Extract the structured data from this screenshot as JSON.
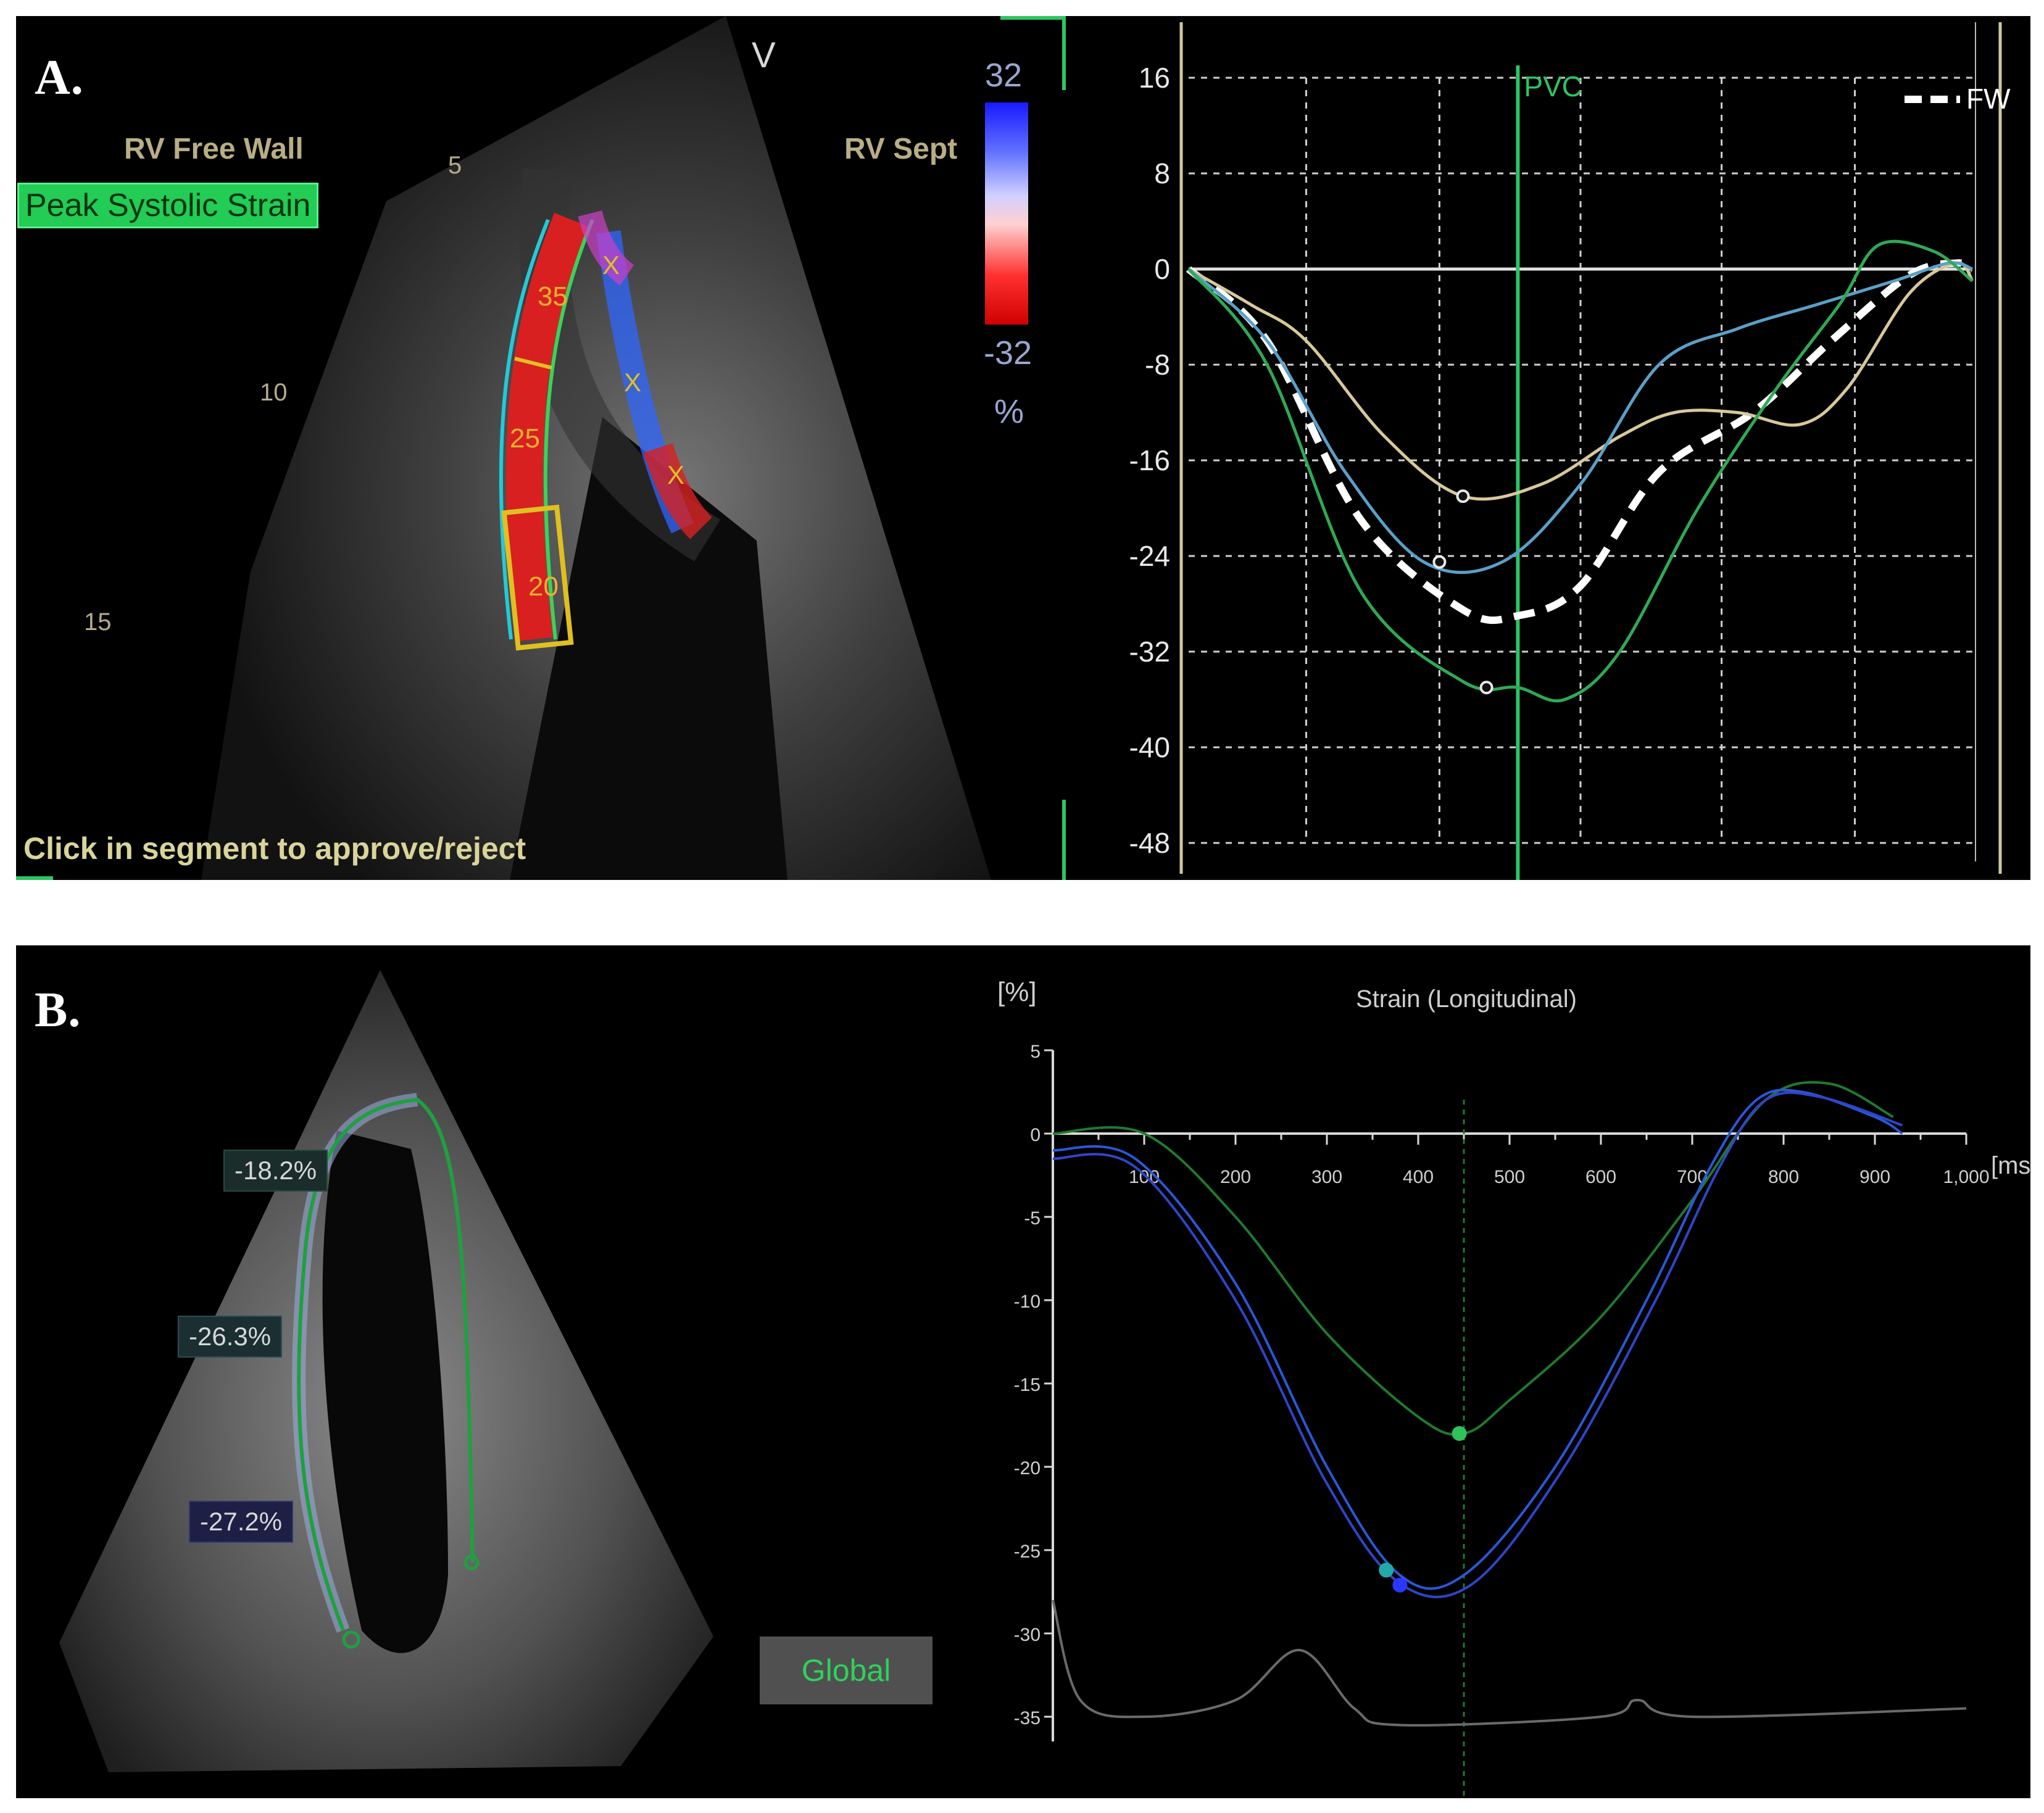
{
  "panel_a": {
    "letter": "A.",
    "echo": {
      "rv_free_wall": "RV Free Wall",
      "rv_sept": "RV Sept",
      "peak_systolic_strain": "Peak Systolic Strain",
      "v_marker": "V",
      "depth_marks": [
        "5",
        "10",
        "15"
      ],
      "segment_values": [
        "35",
        "25",
        "20"
      ],
      "segment_x": "X",
      "colorbar_max": "32",
      "colorbar_min": "-32",
      "colorbar_unit": "%",
      "instruction": "Click in segment to approve/reject"
    }
  },
  "panel_b": {
    "letter": "B.",
    "echo": {
      "segment_values": [
        "-18.2%",
        "-26.3%",
        "-27.2%"
      ],
      "global_button": "Global"
    }
  },
  "chart_data": [
    {
      "type": "line",
      "panel": "A",
      "ylim": [
        -48,
        16
      ],
      "yticks": [
        16,
        8,
        0,
        -8,
        -16,
        -24,
        -32,
        -40,
        -48
      ],
      "x_range": [
        0,
        1
      ],
      "event_marker": {
        "label": "PVC",
        "x": 0.42
      },
      "legend": [
        "FW"
      ],
      "grid": true,
      "series": [
        {
          "name": "FW",
          "color": "#ffffff",
          "dashed": true,
          "points": [
            [
              0,
              0
            ],
            [
              0.1,
              -6
            ],
            [
              0.22,
              -21
            ],
            [
              0.35,
              -28.5
            ],
            [
              0.42,
              -29
            ],
            [
              0.5,
              -26.5
            ],
            [
              0.6,
              -17
            ],
            [
              0.72,
              -12
            ],
            [
              0.82,
              -6
            ],
            [
              0.92,
              -0.5
            ],
            [
              0.98,
              0.5
            ],
            [
              1,
              0
            ]
          ]
        },
        {
          "color": "#d8c89a",
          "points": [
            [
              0,
              0
            ],
            [
              0.08,
              -3
            ],
            [
              0.15,
              -6
            ],
            [
              0.25,
              -14
            ],
            [
              0.35,
              -19
            ],
            [
              0.45,
              -18
            ],
            [
              0.55,
              -14
            ],
            [
              0.62,
              -12
            ],
            [
              0.7,
              -12
            ],
            [
              0.78,
              -13
            ],
            [
              0.84,
              -10
            ],
            [
              0.92,
              -2
            ],
            [
              0.98,
              0.5
            ],
            [
              1,
              -1
            ]
          ]
        },
        {
          "color": "#5aa0c8",
          "points": [
            [
              0,
              0
            ],
            [
              0.1,
              -6
            ],
            [
              0.2,
              -17
            ],
            [
              0.3,
              -24.5
            ],
            [
              0.4,
              -24.5
            ],
            [
              0.5,
              -18
            ],
            [
              0.6,
              -8
            ],
            [
              0.7,
              -5
            ],
            [
              0.8,
              -3
            ],
            [
              0.9,
              -1
            ],
            [
              0.97,
              0.5
            ],
            [
              1,
              0
            ]
          ]
        },
        {
          "color": "#2eaa55",
          "points": [
            [
              0,
              0
            ],
            [
              0.1,
              -8
            ],
            [
              0.22,
              -27
            ],
            [
              0.35,
              -34.5
            ],
            [
              0.42,
              -35
            ],
            [
              0.48,
              -36
            ],
            [
              0.55,
              -32
            ],
            [
              0.65,
              -20
            ],
            [
              0.75,
              -10
            ],
            [
              0.83,
              -3
            ],
            [
              0.88,
              2
            ],
            [
              0.95,
              1.5
            ],
            [
              1,
              -1
            ]
          ]
        }
      ],
      "markers": [
        {
          "series_index": 1,
          "x": 0.35,
          "y": -19
        },
        {
          "series_index": 2,
          "x": 0.32,
          "y": -24.5
        },
        {
          "series_index": 3,
          "x": 0.38,
          "y": -35
        }
      ]
    },
    {
      "type": "line",
      "panel": "B",
      "title": "Strain (Longitudinal)",
      "ylabel": "[%]",
      "xlabel": "[ms]",
      "xlim": [
        0,
        1000
      ],
      "ylim": [
        -35,
        5
      ],
      "xticks": [
        100,
        200,
        300,
        400,
        500,
        600,
        700,
        800,
        900,
        1000
      ],
      "xtick_labels": [
        "100",
        "200",
        "300",
        "400",
        "500",
        "600",
        "700",
        "800",
        "900",
        "1,000"
      ],
      "yticks": [
        5,
        0,
        -5,
        -10,
        -15,
        -20,
        -25,
        -30,
        -35
      ],
      "event_marker": {
        "x": 450
      },
      "grid": false,
      "series": [
        {
          "color": "#1f7a2e",
          "points": [
            [
              0,
              0
            ],
            [
              100,
              0
            ],
            [
              200,
              -5
            ],
            [
              300,
              -12
            ],
            [
              400,
              -17
            ],
            [
              450,
              -18
            ],
            [
              500,
              -16
            ],
            [
              600,
              -11
            ],
            [
              700,
              -4
            ],
            [
              780,
              2
            ],
            [
              850,
              3
            ],
            [
              920,
              1
            ]
          ]
        },
        {
          "color": "#2a58d8",
          "points": [
            [
              0,
              -1
            ],
            [
              90,
              -1.5
            ],
            [
              200,
              -9
            ],
            [
              300,
              -20
            ],
            [
              380,
              -26.5
            ],
            [
              450,
              -26.5
            ],
            [
              550,
              -20
            ],
            [
              650,
              -10
            ],
            [
              720,
              -2
            ],
            [
              770,
              2
            ],
            [
              820,
              2.5
            ],
            [
              900,
              1
            ],
            [
              930,
              0
            ]
          ]
        },
        {
          "color": "#2f45c8",
          "points": [
            [
              0,
              -1.5
            ],
            [
              90,
              -2
            ],
            [
              200,
              -10
            ],
            [
              300,
              -21
            ],
            [
              380,
              -27
            ],
            [
              460,
              -27
            ],
            [
              560,
              -20
            ],
            [
              660,
              -10
            ],
            [
              730,
              -2
            ],
            [
              780,
              2
            ],
            [
              840,
              2.2
            ],
            [
              930,
              0.5
            ]
          ]
        },
        {
          "color": "#6a6a6a",
          "points": [
            [
              0,
              -28
            ],
            [
              30,
              -34
            ],
            [
              100,
              -35
            ],
            [
              200,
              -34
            ],
            [
              270,
              -31
            ],
            [
              330,
              -34.5
            ],
            [
              380,
              -35.5
            ],
            [
              600,
              -35
            ],
            [
              640,
              -34
            ],
            [
              700,
              -35
            ],
            [
              1000,
              -34.5
            ]
          ]
        }
      ],
      "markers": [
        {
          "series_index": 0,
          "x": 445,
          "y": -18,
          "color": "#2fc25a"
        },
        {
          "series_index": 1,
          "x": 365,
          "y": -26.2,
          "color": "#22aaaa"
        },
        {
          "series_index": 2,
          "x": 380,
          "y": -27.1,
          "color": "#2a38ff"
        }
      ]
    }
  ]
}
